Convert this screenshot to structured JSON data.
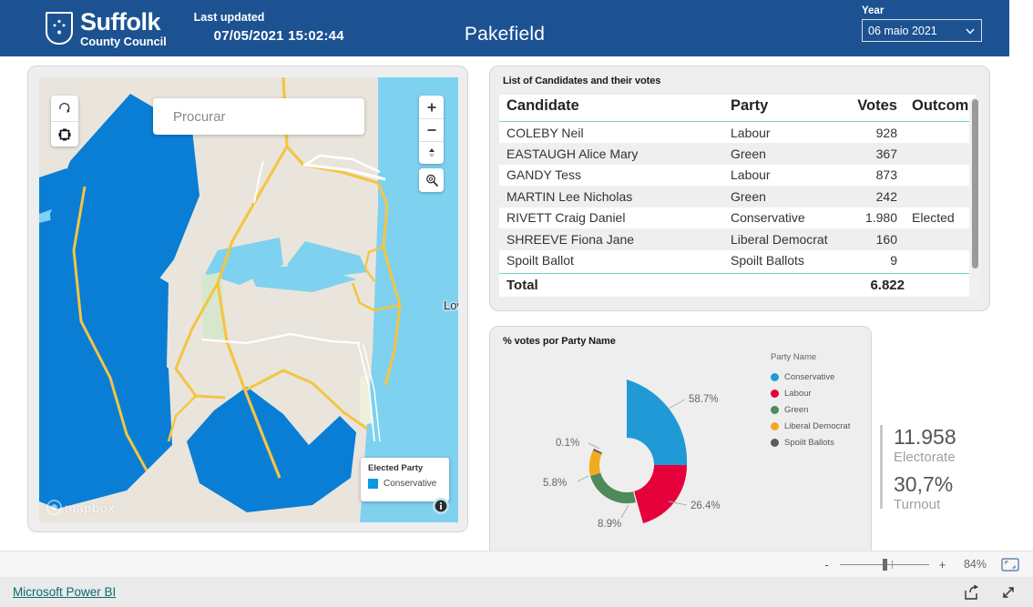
{
  "header": {
    "logo_main": "Suffolk",
    "logo_sub": "County Council",
    "crest_icon": "suffolk-crest-icon",
    "last_updated_label": "Last updated",
    "last_updated_value": "07/05/2021 15:02:44",
    "page_title": "Pakefield",
    "year_label": "Year",
    "year_value": "06 maio 2021",
    "chevron_icon": "chevron-down-icon",
    "brand_blue": "#1c5292"
  },
  "map": {
    "search_placeholder": "Procurar",
    "search_value": "",
    "search_icon": "search-icon",
    "ctrl_reset_icon": "reset-bearing-icon",
    "ctrl_fullscreen_icon": "expand-frame-icon",
    "zoom_in_icon": "plus-icon",
    "zoom_out_icon": "minus-icon",
    "compass_icon": "compass-icon",
    "magnifier_icon": "magnifier-icon",
    "info_icon": "info-icon",
    "attribution": "mapbox",
    "attribution_icon": "mapbox-logo-icon",
    "town_label": "Lowestoft",
    "legend": {
      "title": "Elected Party",
      "items": [
        {
          "label": "Conservative",
          "color": "#0a9ae3"
        }
      ]
    },
    "colors": {
      "land": "#e9e5dd",
      "selected_area": "#0a7ed4",
      "water": "#7fd1f0",
      "road_major": "#f4c542",
      "road_minor": "#ffffff",
      "park": "#d7e7cd"
    }
  },
  "table": {
    "title": "List of Candidates and their votes",
    "columns": [
      "Candidate",
      "Party",
      "Votes",
      "Outcome"
    ],
    "rows": [
      {
        "candidate": "COLEBY Neil",
        "party": "Labour",
        "votes": "928",
        "outcome": ""
      },
      {
        "candidate": "EASTAUGH Alice Mary",
        "party": "Green",
        "votes": "367",
        "outcome": ""
      },
      {
        "candidate": "GANDY Tess",
        "party": "Labour",
        "votes": "873",
        "outcome": ""
      },
      {
        "candidate": "MARTIN Lee Nicholas",
        "party": "Green",
        "votes": "242",
        "outcome": ""
      },
      {
        "candidate": "RIVETT Craig Daniel",
        "party": "Conservative",
        "votes": "1.980",
        "outcome": "Elected"
      },
      {
        "candidate": "SHREEVE Fiona Jane",
        "party": "Liberal Democrat",
        "votes": "160",
        "outcome": ""
      },
      {
        "candidate": "Spoilt Ballot",
        "party": "Spoilt Ballots",
        "votes": "9",
        "outcome": ""
      }
    ],
    "total_label": "Total",
    "total_value": "6.822"
  },
  "chart_data": {
    "type": "pie",
    "title": "% votes por Party Name",
    "legend_title": "Party Name",
    "legend_position": "right",
    "categories": [
      "Conservative",
      "Labour",
      "Green",
      "Liberal Democrat",
      "Spoilt Ballots"
    ],
    "values": [
      58.7,
      26.4,
      8.9,
      5.8,
      0.1
    ],
    "labels": [
      "58.7%",
      "26.4%",
      "8.9%",
      "5.8%",
      "0.1%"
    ],
    "colors": [
      "#1f9ad6",
      "#e5003c",
      "#4e8a5a",
      "#f2ab1e",
      "#5c5c5c"
    ],
    "xlabel": "",
    "ylabel": ""
  },
  "kpi": {
    "electorate_value": "11.958",
    "electorate_label": "Electorate",
    "turnout_value": "30,7%",
    "turnout_label": "Turnout"
  },
  "statusbar": {
    "zoom_minus": "-",
    "zoom_plus": "+",
    "zoom_level": "84%",
    "fit_icon": "fit-to-page-icon"
  },
  "footer": {
    "powerbi_link": "Microsoft Power BI",
    "share_icon": "share-icon",
    "fullscreen_icon": "fullscreen-arrow-icon"
  }
}
